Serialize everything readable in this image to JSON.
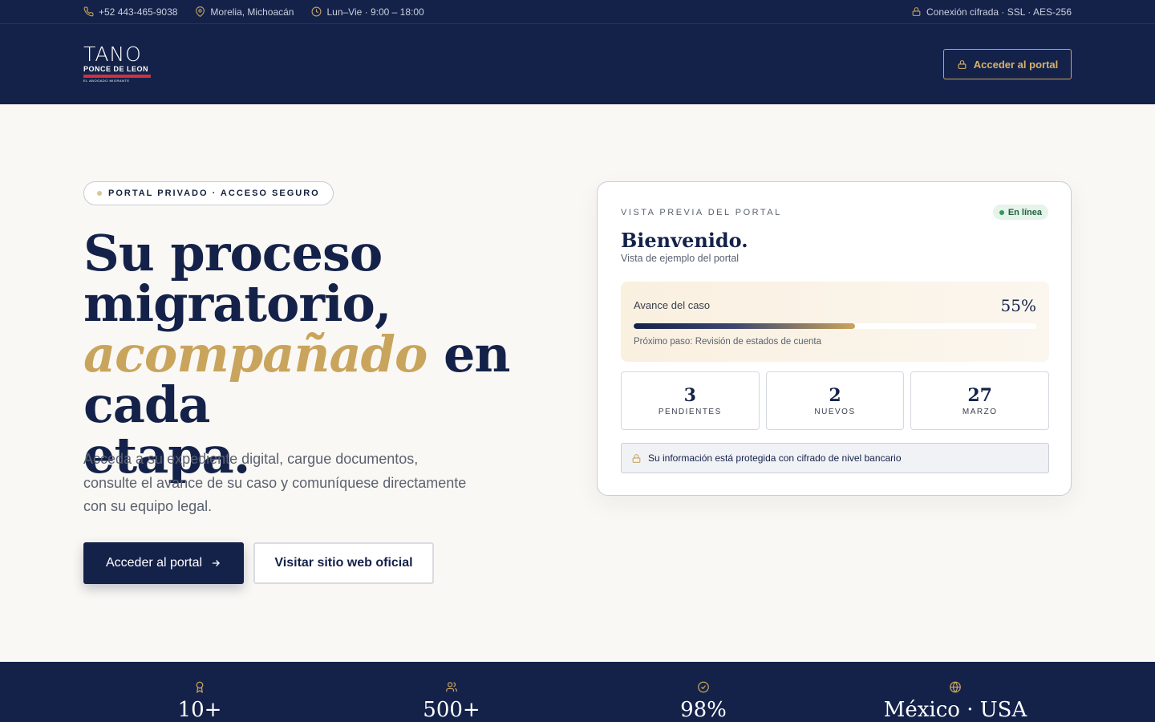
{
  "topbar": {
    "phone": "+52 443-465-9038",
    "location": "Morelia, Michoacán",
    "hours": "Lun–Vie · 9:00 – 18:00",
    "security": "Conexión cifrada · SSL · AES-256"
  },
  "header": {
    "logo": {
      "line1": "TANO",
      "line2": "PONCE DE LEON",
      "line3": "EL ABOGADO MIGRANTE"
    },
    "portal_button": "Acceder al portal"
  },
  "hero": {
    "badge": "PORTAL PRIVADO · ACCESO SEGURO",
    "headline_1": "Su proceso",
    "headline_2": "migratorio,",
    "headline_accent": "acompañado",
    "headline_3": " en cada",
    "headline_4": "etapa.",
    "lead": "Acceda a su expediente digital, cargue documentos, consulte el avance de su caso y comuníquese directamente con su equipo legal.",
    "primary_cta": "Acceder al portal",
    "secondary_cta": "Visitar sitio web oficial"
  },
  "preview": {
    "eyebrow": "VISTA PREVIA DEL PORTAL",
    "status": "En línea",
    "welcome": "Bienvenido.",
    "subtitle": "Vista de ejemplo del portal",
    "progress_label": "Avance del caso",
    "progress_text": "55%",
    "progress_value": 0.55,
    "next_step": "Próximo paso: Revisión de estados de cuenta",
    "stats": [
      {
        "num": "3",
        "cap": "PENDIENTES"
      },
      {
        "num": "2",
        "cap": "NUEVOS"
      },
      {
        "num": "27",
        "cap": "MARZO"
      }
    ],
    "secure_note": "Su información está protegida con cifrado de nivel bancario"
  },
  "band": [
    {
      "icon": "award-icon",
      "value": "10+"
    },
    {
      "icon": "users-icon",
      "value": "500+"
    },
    {
      "icon": "check-circle-icon",
      "value": "98%"
    },
    {
      "icon": "globe-icon",
      "value": "México · USA"
    }
  ],
  "colors": {
    "navy": "#14224a",
    "gold": "#c9a45c",
    "cream": "#faf8f4"
  }
}
